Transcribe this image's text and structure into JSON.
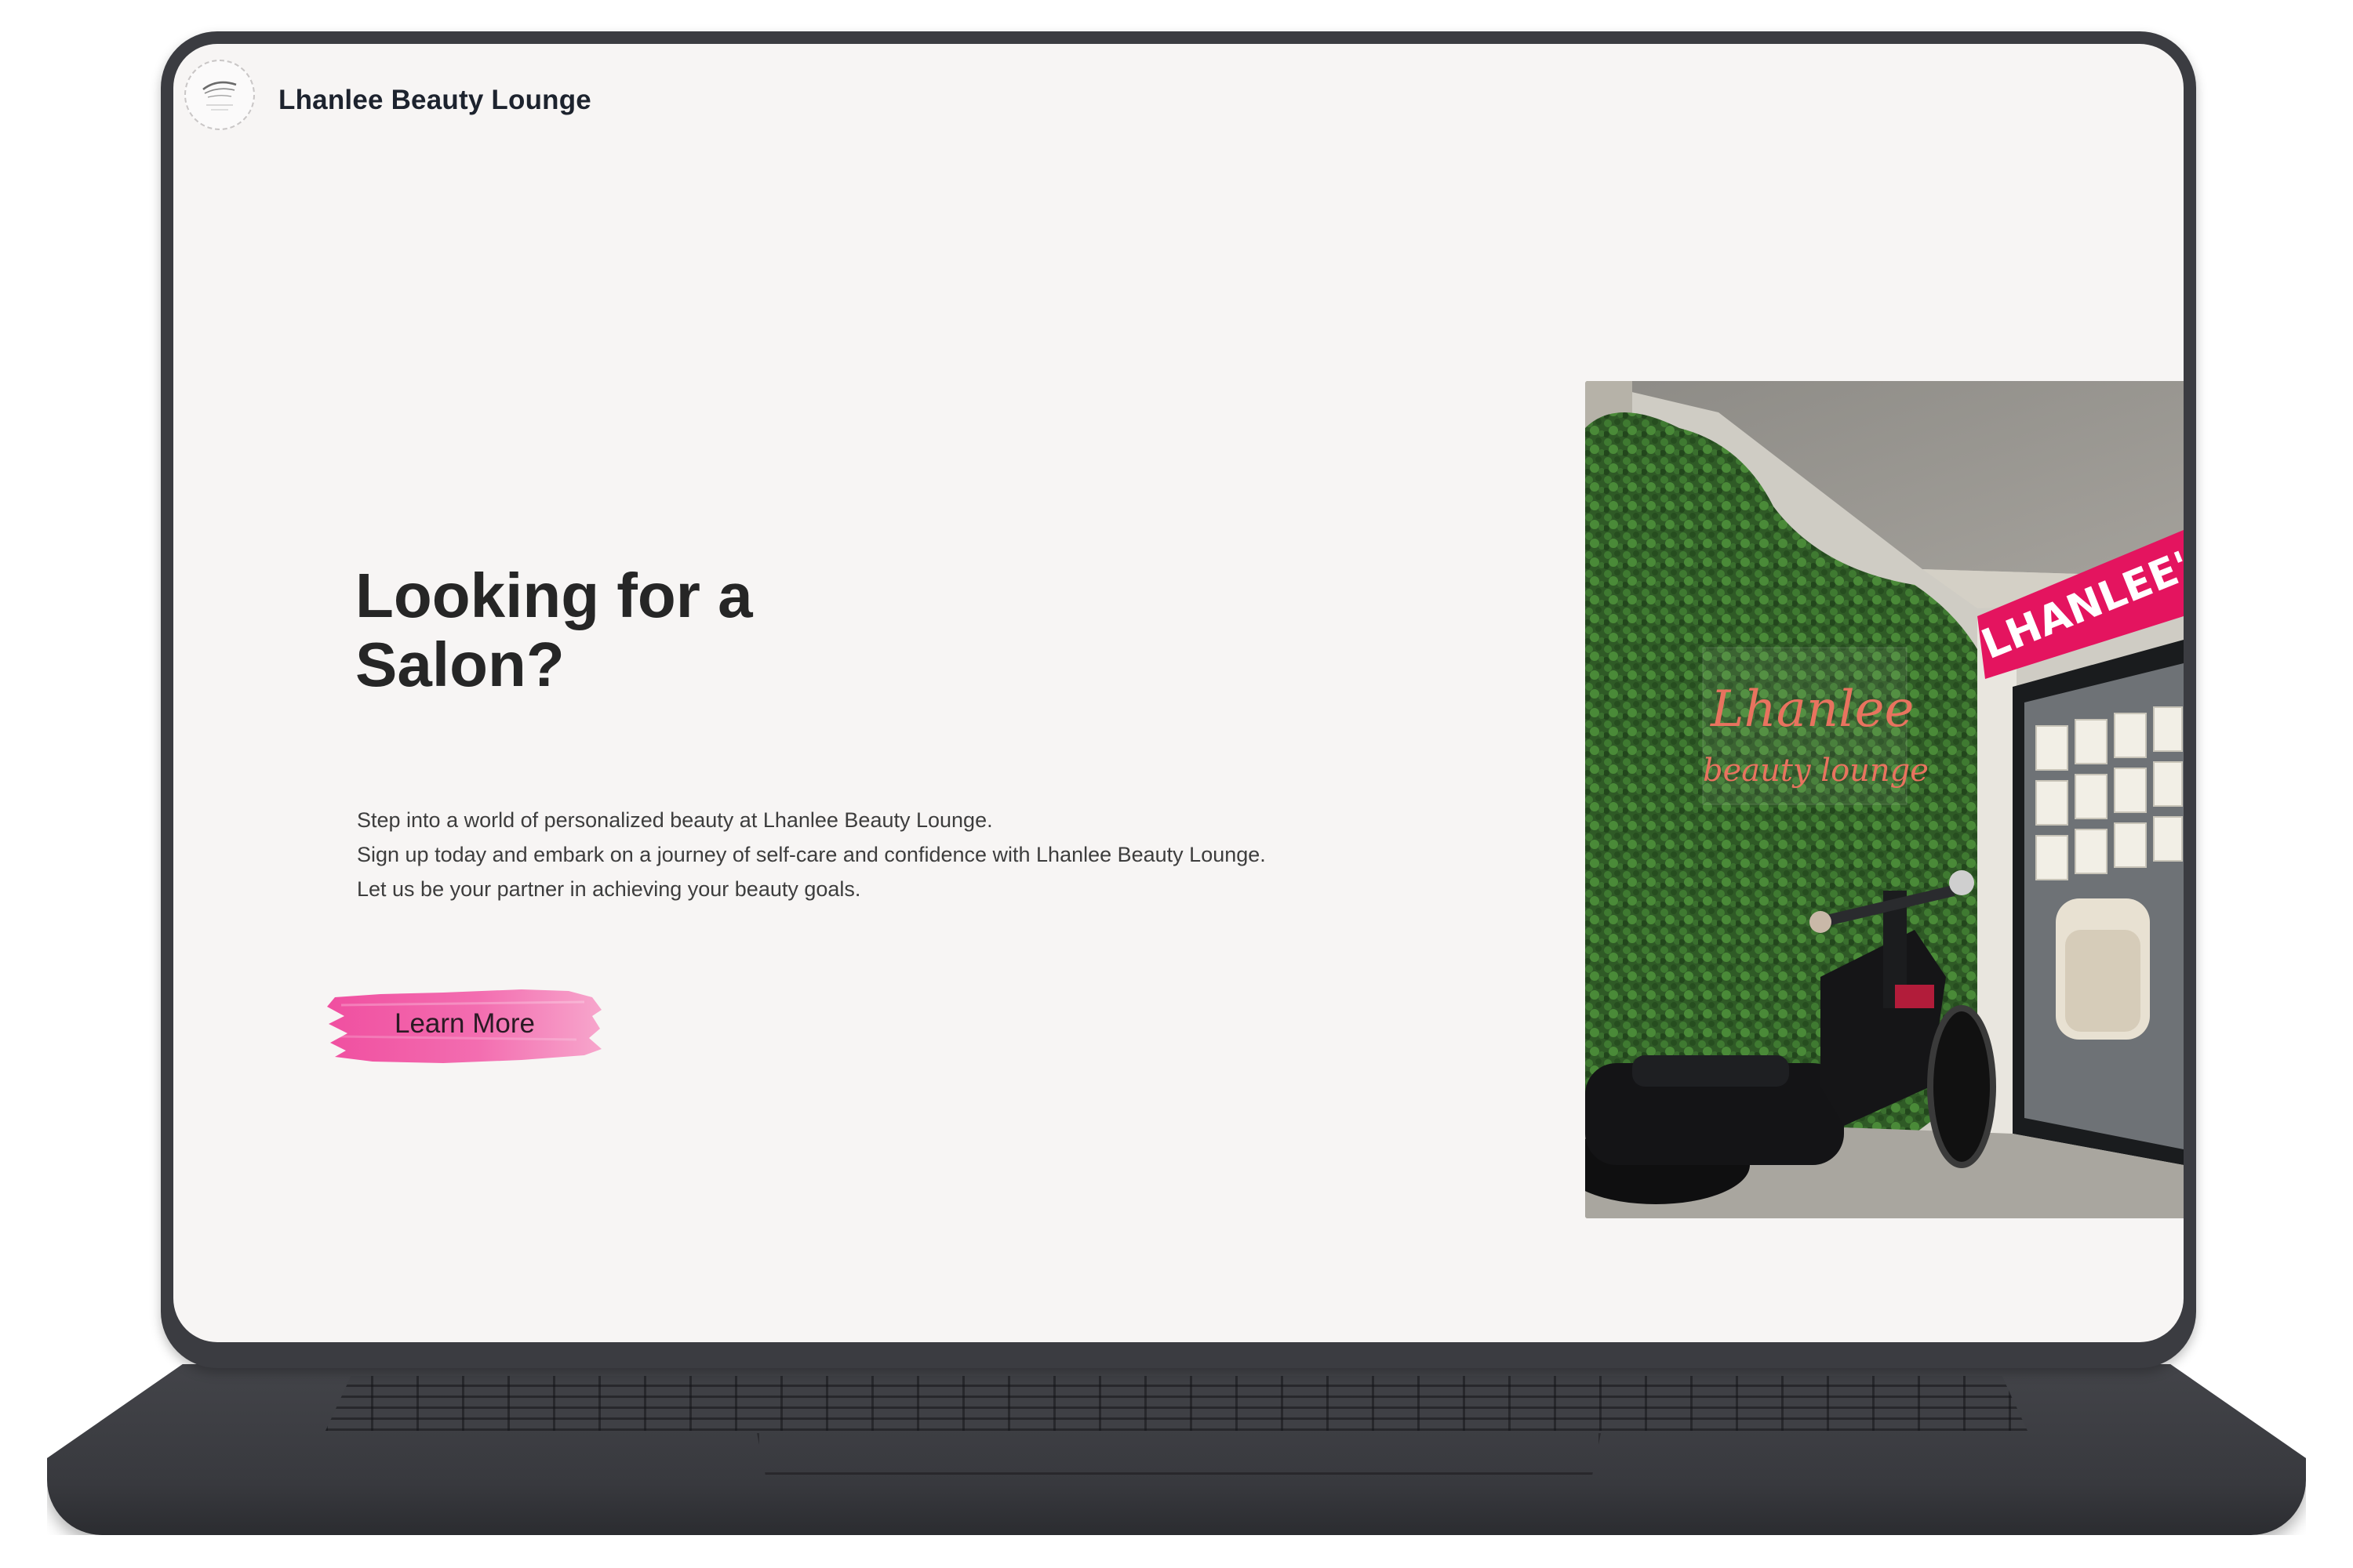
{
  "header": {
    "brand_name": "Lhanlee Beauty Lounge",
    "logo_icon": "eyebrow-logo-icon"
  },
  "hero": {
    "title_line1": "Looking for a",
    "title_line2": "Salon?",
    "description": [
      "Step into a world of personalized beauty at Lhanlee Beauty Lounge.",
      "Sign up today and embark on a journey of self-care and confidence with Lhanlee Beauty Lounge.",
      "Let us be your partner in achieving your beauty goals."
    ],
    "cta_label": "Learn More",
    "cta_color": "#f05fa6"
  },
  "photo": {
    "neon_sign_line1": "Lhanlee",
    "neon_sign_line2": "beauty lounge",
    "banner_text": "LHANLEE'S BEA"
  },
  "colors": {
    "page_background": "#f7f5f4",
    "accent_pink": "#f05fa6",
    "banner_red": "#e4145f",
    "device_frame": "#3b3c41"
  }
}
